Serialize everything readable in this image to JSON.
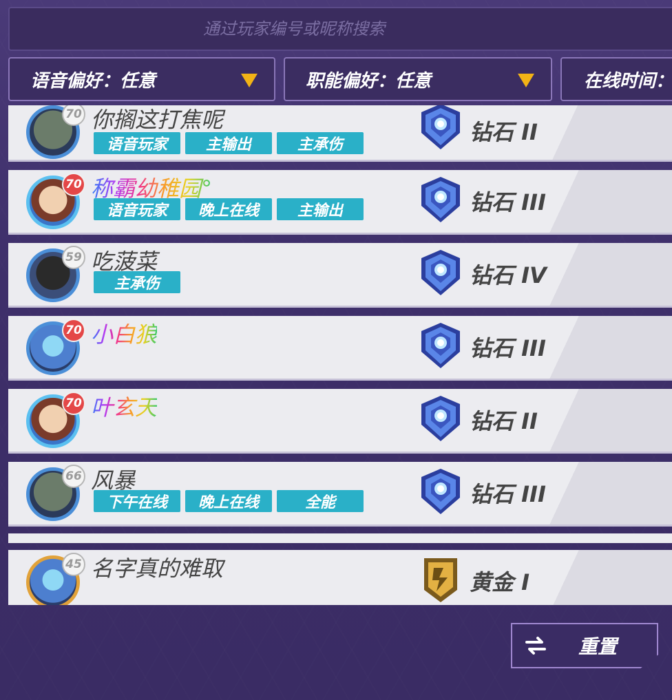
{
  "search": {
    "placeholder": "通过玩家编号或昵称搜索"
  },
  "filters": [
    {
      "label": "语音偏好：任意"
    },
    {
      "label": "职能偏好：任意"
    },
    {
      "label": "在线时间："
    }
  ],
  "players": [
    {
      "name": "你搁这打焦呢",
      "level": "70",
      "tags": [
        "语音玩家",
        "主输出",
        "主承伤"
      ],
      "rank": "钻石 II",
      "rank_tier": "diamond",
      "avatar_style": "green-blue",
      "name_style": "normal"
    },
    {
      "name": "称霸幼稚园°",
      "level": "70",
      "tags": [
        "语音玩家",
        "晚上在线",
        "主输出"
      ],
      "rank": "钻石 III",
      "rank_tier": "diamond",
      "avatar_style": "color",
      "name_style": "rainbow"
    },
    {
      "name": "吃菠菜",
      "level": "59",
      "tags": [
        "主承伤"
      ],
      "rank": "钻石 IV",
      "rank_tier": "diamond",
      "avatar_style": "dark",
      "name_style": "normal"
    },
    {
      "name": "小白狼",
      "level": "70",
      "tags": [],
      "rank": "钻石 III",
      "rank_tier": "diamond",
      "avatar_style": "crystal",
      "name_style": "rainbow"
    },
    {
      "name": "叶玄天",
      "level": "70",
      "tags": [],
      "rank": "钻石 II",
      "rank_tier": "diamond",
      "avatar_style": "gold",
      "name_style": "rainbow"
    },
    {
      "name": "风暴",
      "level": "66",
      "tags": [
        "下午在线",
        "晚上在线",
        "全能"
      ],
      "rank": "钻石 III",
      "rank_tier": "diamond",
      "avatar_style": "green-blue",
      "name_style": "normal"
    },
    {
      "name": "名字真的难取",
      "level": "45",
      "tags": [],
      "rank": "黄金 I",
      "rank_tier": "gold",
      "avatar_style": "crystal-gold",
      "name_style": "normal"
    }
  ],
  "reset_button": {
    "label": "重置",
    "icon": "swap-arrows-icon"
  },
  "colors": {
    "tag_bg": "#2ab0c8",
    "filter_arrow": "#f2b316",
    "diamond": "#3a5fc8",
    "gold": "#d6a13a",
    "level_badge_red": "#e44747"
  }
}
